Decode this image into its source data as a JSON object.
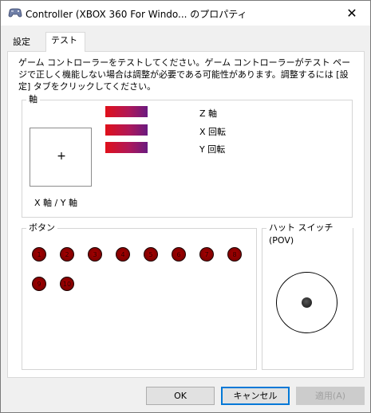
{
  "window": {
    "title": "Controller (XBOX 360 For Windo... のプロパティ",
    "close_glyph": "✕"
  },
  "tabs": [
    {
      "label": "設定",
      "selected": false
    },
    {
      "label": "テスト",
      "selected": true
    }
  ],
  "description": "ゲーム コントローラーをテストしてください。ゲーム コントローラーがテスト ページで正しく機能しない場合は調整が必要である可能性があります。調整するには [設定] タブをクリックしてください。",
  "axes_group": {
    "label": "軸",
    "xy_label": "X 軸 / Y 軸",
    "crosshair": "+",
    "bars": [
      {
        "label": "Z 軸"
      },
      {
        "label": "X 回転"
      },
      {
        "label": "Y 回転"
      }
    ]
  },
  "buttons_group": {
    "label": "ボタン",
    "buttons": [
      "1",
      "2",
      "3",
      "4",
      "5",
      "6",
      "7",
      "8",
      "9",
      "10"
    ]
  },
  "pov_group": {
    "label": "ハット スイッチ (POV)"
  },
  "dialog_buttons": {
    "ok": "OK",
    "cancel": "キャンセル",
    "apply": "適用(A)"
  },
  "colors": {
    "bar_start": "#e0101a",
    "bar_end": "#6a1a80",
    "button_fill": "#800000",
    "focus_border": "#0078d7"
  }
}
